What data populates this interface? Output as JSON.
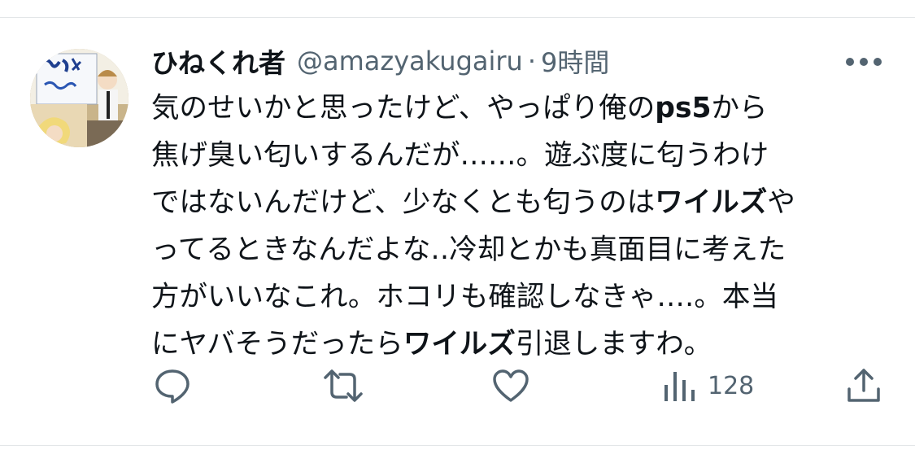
{
  "tweet": {
    "author": {
      "display_name": "ひねくれ者",
      "handle": "@amazyakugairu",
      "avatar_icon": "profile-avatar",
      "avatar_sign_text": "銀の匙 ようこそ"
    },
    "separator": "·",
    "time": "9時間",
    "more_icon": "more-horizontal-icon",
    "text_lines": [
      [
        {
          "t": "気のせいかと思ったけど、やっぱり俺の"
        },
        {
          "t": "ps5",
          "bold": true
        },
        {
          "t": "から"
        }
      ],
      [
        {
          "t": "焦げ臭い匂いするんだが‥‥‥。遊ぶ度に匂うわけ"
        }
      ],
      [
        {
          "t": "ではないんだけど、少なくとも匂うのは"
        },
        {
          "t": "ワイルズ",
          "bold": true
        },
        {
          "t": "や"
        }
      ],
      [
        {
          "t": "ってるときなんだよな‥冷却とかも真面目に考えた"
        }
      ],
      [
        {
          "t": "方がいいなこれ。ホコリも確認しなきゃ‥‥。本当"
        }
      ],
      [
        {
          "t": "にヤバそうだったら"
        },
        {
          "t": "ワイルズ",
          "bold": true
        },
        {
          "t": "引退しますわ。"
        }
      ]
    ],
    "actions": {
      "reply_icon": "reply-icon",
      "retweet_icon": "retweet-icon",
      "like_icon": "heart-icon",
      "views_icon": "views-bar-chart-icon",
      "views_count": "128",
      "share_icon": "share-icon"
    },
    "colors": {
      "text": "#0f1419",
      "secondary": "#536471",
      "divider": "#e3e6e8"
    }
  }
}
